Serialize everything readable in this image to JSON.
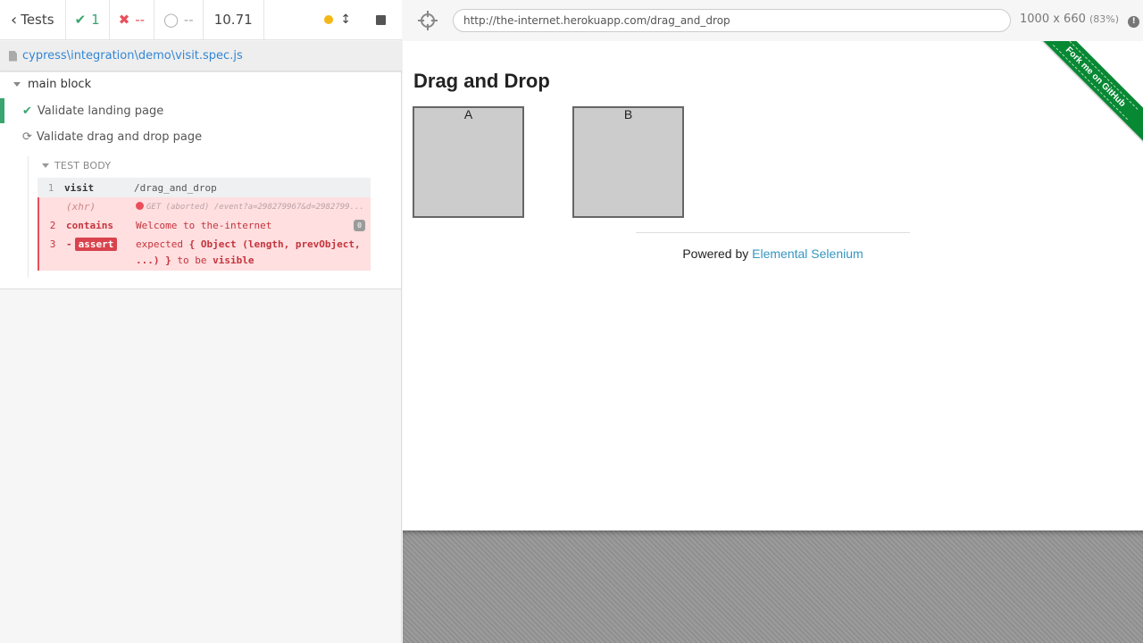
{
  "reporter": {
    "stats": {
      "tests_label": "Tests",
      "passed": "1",
      "failed": "--",
      "pending": "--",
      "duration": "10.71"
    },
    "spec_path": "cypress\\integration\\demo\\visit.spec.js",
    "suite": {
      "title": "main block",
      "tests": [
        {
          "title": "Validate landing page",
          "state": "passed"
        },
        {
          "title": "Validate drag and drop page",
          "state": "running"
        }
      ]
    },
    "test_body": {
      "header": "TEST BODY",
      "commands": {
        "visit": {
          "num": "1",
          "name": "visit",
          "message": "/drag_and_drop"
        },
        "xhr": {
          "name": "(xhr)",
          "message": "GET (aborted) /event?a=298279967&d=2982799..."
        },
        "contains": {
          "num": "2",
          "name": "contains",
          "message": "Welcome to the-internet",
          "badge": "0"
        },
        "assert": {
          "num": "3",
          "prefix": "-",
          "name": "assert",
          "msg_expected": "expected",
          "msg_object": "{ Object (length, prevObject, ...) }",
          "msg_tobe": "to be",
          "msg_visible": "visible"
        }
      }
    }
  },
  "aut": {
    "url": "http://the-internet.herokuapp.com/drag_and_drop",
    "viewport": "1000 x 660",
    "scale": "(83%)",
    "page": {
      "title": "Drag and Drop",
      "column_a": "A",
      "column_b": "B",
      "footer_prefix": "Powered by",
      "footer_link": "Elemental Selenium",
      "ribbon": "Fork me on GitHub"
    }
  },
  "colors": {
    "pass": "#3aa56f",
    "fail": "#e94f5a",
    "link": "#3386d4",
    "ribbon": "#078833"
  }
}
